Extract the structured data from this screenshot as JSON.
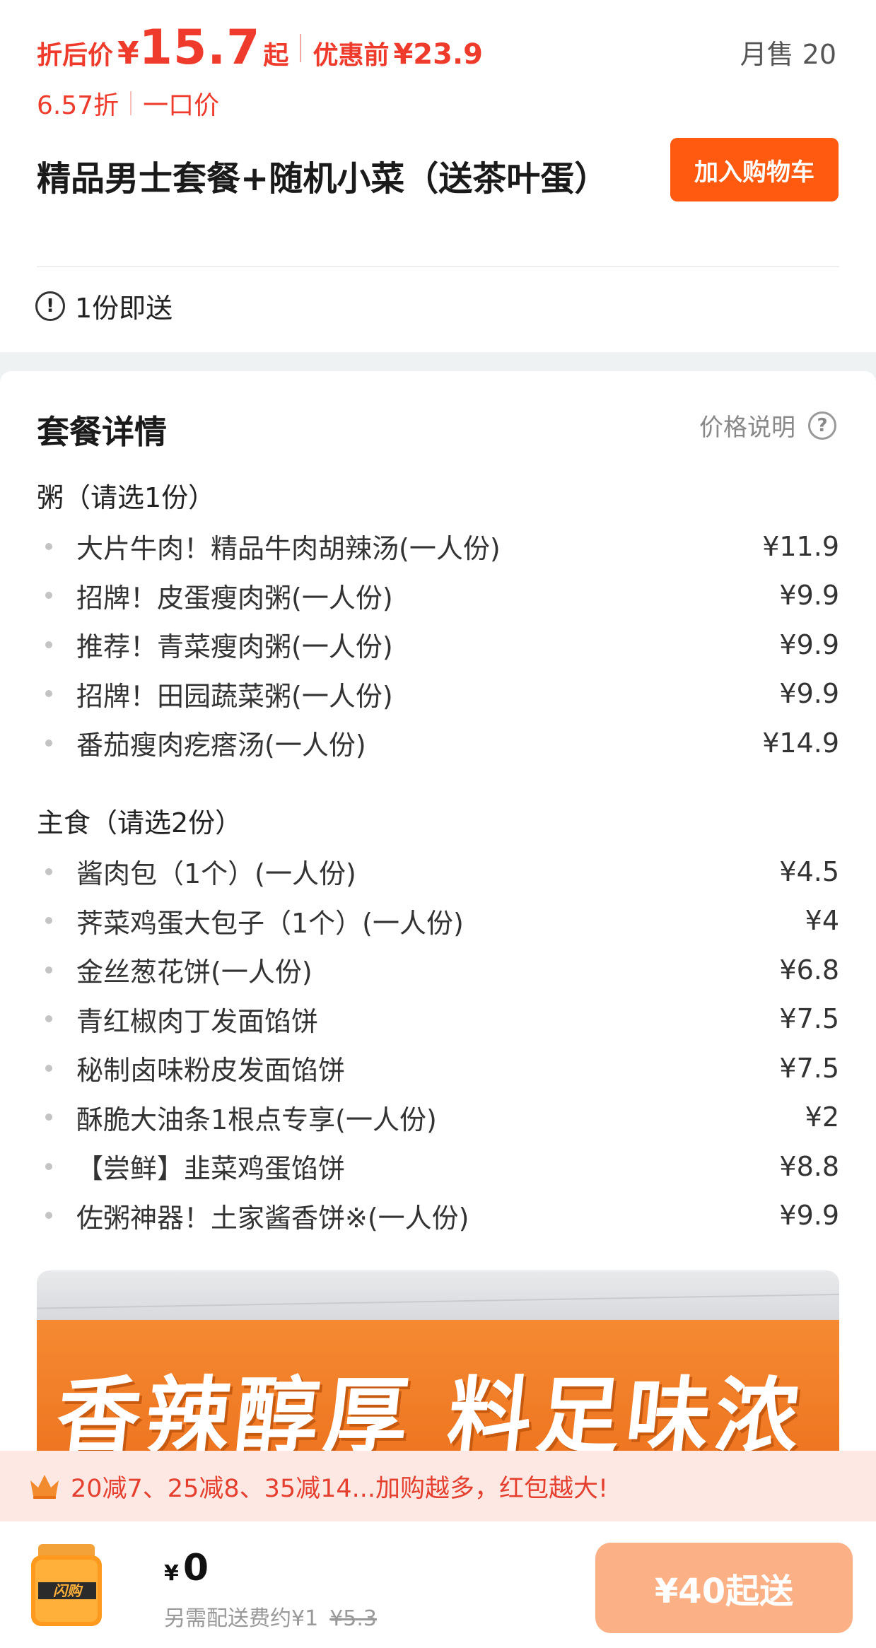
{
  "product": {
    "discount_price_label": "折后价",
    "yen": "¥",
    "discount_price": "15.7",
    "price_suffix": "起",
    "original_price_label": "优惠前",
    "original_price": "¥23.9",
    "monthly_sales": "月售 20",
    "discount_rate": "6.57折",
    "price_type": "一口价",
    "title": "精品男士套餐+随机小菜（送茶叶蛋）",
    "add_to_cart": "加入购物车",
    "notice_icon": "!",
    "notice": "1份即送"
  },
  "details": {
    "title": "套餐详情",
    "price_note": "价格说明",
    "help_icon": "?",
    "groups": [
      {
        "title": "粥（请选1份）",
        "items": [
          {
            "name": "大片牛肉！精品牛肉胡辣汤(一人份)",
            "price": "¥11.9"
          },
          {
            "name": "招牌！皮蛋瘦肉粥(一人份)",
            "price": "¥9.9"
          },
          {
            "name": "推荐！青菜瘦肉粥(一人份)",
            "price": "¥9.9"
          },
          {
            "name": "招牌！田园蔬菜粥(一人份)",
            "price": "¥9.9"
          },
          {
            "name": "番茄瘦肉疙瘩汤(一人份)",
            "price": "¥14.9"
          }
        ]
      },
      {
        "title": "主食（请选2份）",
        "items": [
          {
            "name": "酱肉包（1个）(一人份)",
            "price": "¥4.5"
          },
          {
            "name": "荠菜鸡蛋大包子（1个）(一人份)",
            "price": "¥4"
          },
          {
            "name": "金丝葱花饼(一人份)",
            "price": "¥6.8"
          },
          {
            "name": "青红椒肉丁发面馅饼",
            "price": "¥7.5"
          },
          {
            "name": "秘制卤味粉皮发面馅饼",
            "price": "¥7.5"
          },
          {
            "name": "酥脆大油条1根点专享(一人份)",
            "price": "¥2"
          },
          {
            "name": "【尝鲜】韭菜鸡蛋馅饼",
            "price": "¥8.8"
          },
          {
            "name": "佐粥神器！土家酱香饼※(一人份)",
            "price": "¥9.9"
          }
        ]
      }
    ]
  },
  "banner": {
    "text": "香辣醇厚 料足味浓"
  },
  "promo": {
    "icon": "crown-icon",
    "text": "20减7、25减8、35减14...加购越多，红包越大!"
  },
  "bottom_bar": {
    "cart_icon_label": "闪购",
    "yen": "¥",
    "total": "0",
    "delivery_fee_text": "另需配送费约¥1",
    "delivery_fee_original": "¥5.3",
    "min_order": "¥40起送"
  },
  "colors": {
    "accent": "#ff5a0f",
    "price_red": "#ee3b2c",
    "promo_bg": "#fde8e4",
    "min_order_btn": "#fbb085"
  }
}
